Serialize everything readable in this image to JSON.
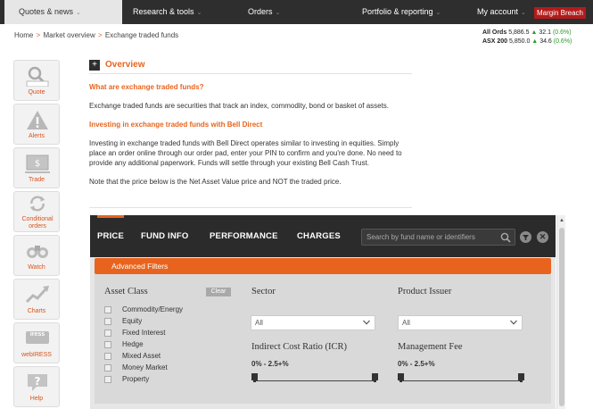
{
  "nav": {
    "items": [
      {
        "label": "Quotes & news"
      },
      {
        "label": "Research & tools"
      },
      {
        "label": "Orders"
      },
      {
        "label": "Portfolio & reporting"
      },
      {
        "label": "My account"
      }
    ],
    "margin_breach": "Margin Breach"
  },
  "breadcrumb": {
    "home": "Home",
    "market": "Market overview",
    "current": "Exchange traded funds",
    "separator": ">"
  },
  "indices": [
    {
      "name": "All Ords",
      "value": "5,886.5",
      "change": "32.1",
      "pct": "(0.6%)"
    },
    {
      "name": "ASX 200",
      "value": "5,850.0",
      "change": "34.6",
      "pct": "(0.6%)"
    }
  ],
  "sidebar": {
    "items": [
      {
        "label": "Quote",
        "icon": "magnifier-icon"
      },
      {
        "label": "Alerts",
        "icon": "warning-icon"
      },
      {
        "label": "Trade",
        "icon": "cash-icon"
      },
      {
        "label": "Conditional orders",
        "icon": "recycle-icon"
      },
      {
        "label": "Watch",
        "icon": "binoculars-icon"
      },
      {
        "label": "Charts",
        "icon": "chart-icon"
      },
      {
        "label": "webIRESS",
        "icon": "iress-icon",
        "badge": "iress"
      },
      {
        "label": "Help",
        "icon": "help-icon"
      }
    ]
  },
  "overview": {
    "toggle": "+",
    "title": "Overview",
    "q1": "What are exchange traded funds?",
    "p1": "Exchange traded funds are securities that track an index, commodity, bond or basket of assets.",
    "q2": "Investing in exchange traded funds with Bell Direct",
    "p2": "Investing in exchange traded funds with Bell Direct operates similar to investing in equities. Simply place an order online through our order pad, enter your PIN to confirm and you're done. No need to provide any additional paperwork. Funds will settle through your existing Bell Cash Trust.",
    "p3": "Note that the price below is the Net Asset Value price and NOT the traded price."
  },
  "widget": {
    "tabs": [
      "PRICE",
      "FUND INFO",
      "PERFORMANCE",
      "CHARGES"
    ],
    "search_placeholder": "Search by fund name or identifiers",
    "advanced_filters": "Advanced Filters",
    "asset_class": {
      "title": "Asset Class",
      "clear": "Clear",
      "options": [
        "Commodity/Energy",
        "Equity",
        "Fixed Interest",
        "Hedge",
        "Mixed Asset",
        "Money Market",
        "Property"
      ]
    },
    "sector": {
      "title": "Sector",
      "value": "All"
    },
    "issuer": {
      "title": "Product Issuer",
      "value": "All"
    },
    "icr": {
      "title": "Indirect Cost Ratio (ICR)",
      "range": "0% - 2.5+%"
    },
    "fee": {
      "title": "Management Fee",
      "range": "0% - 2.5+%"
    }
  },
  "colors": {
    "accent": "#e8641e",
    "dark": "#2b2b2b",
    "alert_red": "#b31b1b",
    "positive": "#2a9a2a"
  }
}
